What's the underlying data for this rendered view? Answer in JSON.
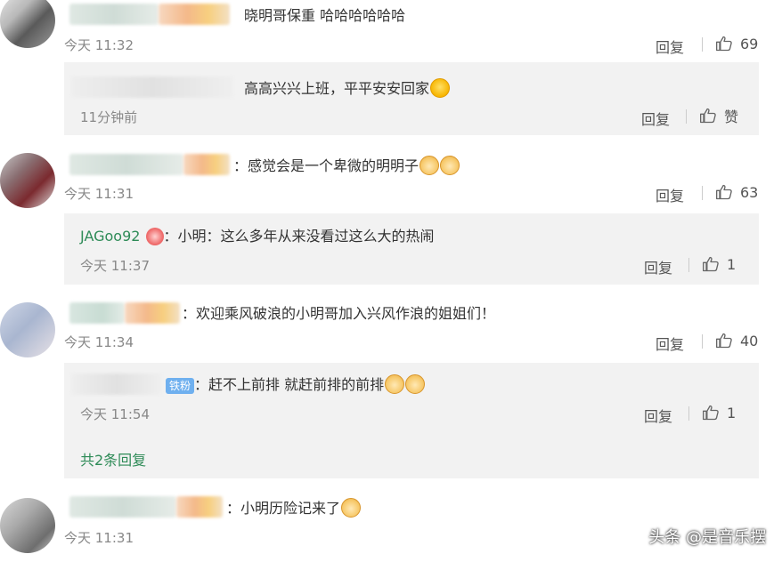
{
  "comments": [
    {
      "text": "晓明哥保重 哈哈哈哈哈哈",
      "time": "今天 11:32",
      "reply_label": "回复",
      "likes": "69",
      "sub_reply": {
        "text": "高高兴兴上班，平平安安回家",
        "time": "11分钟前",
        "reply_label": "回复",
        "like_label": "赞"
      }
    },
    {
      "text": "：感觉会是一个卑微的明明子",
      "time": "今天 11:31",
      "reply_label": "回复",
      "likes": "63",
      "sub_reply": {
        "username": "JAGoo92",
        "text": "：小明：这么多年从来没看过这么大的热闹",
        "time": "今天 11:37",
        "reply_label": "回复",
        "likes": "1"
      }
    },
    {
      "text": "：欢迎乘风破浪的小明哥加入兴风作浪的姐姐们！",
      "time": "今天 11:34",
      "reply_label": "回复",
      "likes": "40",
      "sub_reply": {
        "badge": "铁粉",
        "text": "：赶不上前排 就赶前排的前排",
        "time": "今天 11:54",
        "reply_label": "回复",
        "likes": "1"
      },
      "more_replies": "共2条回复"
    },
    {
      "text": "：小明历险记来了",
      "time": "今天 11:31"
    }
  ],
  "watermark": "头条 @是音乐摆",
  "icons": {
    "like": "thumbs-up-icon",
    "doge": "doge-emoji-icon",
    "laugh": "laughing-emoji-icon",
    "crown": "vip-crown-icon"
  },
  "colors": {
    "username": "#2e8b57",
    "sub_box_bg": "#f2f2f2",
    "fans_badge": "#6fb0ef"
  }
}
